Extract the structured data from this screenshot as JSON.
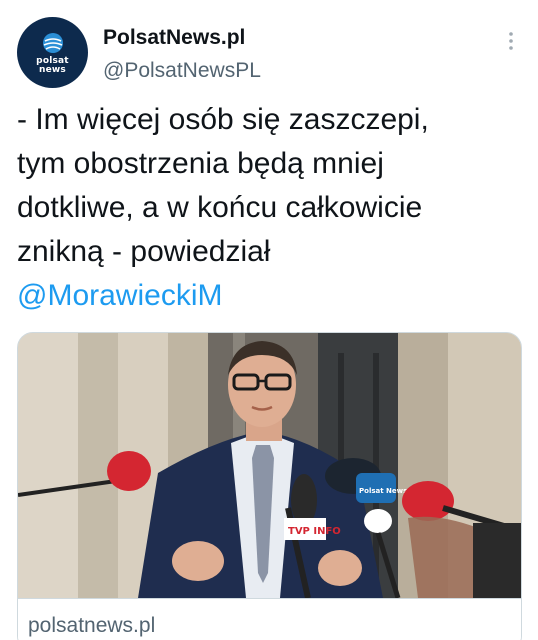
{
  "author": {
    "display_name": "PolsatNews.pl",
    "handle": "@PolsatNewsPL",
    "avatar_text_line1": "polsat",
    "avatar_text_line2": "news",
    "avatar_icon": "globe-icon"
  },
  "menu": {
    "icon": "more-vertical-icon"
  },
  "tweet": {
    "line1": "- Im więcej osób się zaszczepi,",
    "line2": "tym obostrzenia będą mniej",
    "line3": "dotkliwe, a w końcu całkowicie",
    "line4": "znikną - powiedział",
    "mention": "@MorawieckiM"
  },
  "card": {
    "domain": "polsatnews.pl",
    "image_description": "man in suit speaking to microphones",
    "mic_label_1": "TVP INFO",
    "mic_label_2": "Polsat News"
  },
  "colors": {
    "link": "#1d9bf0",
    "secondary_text": "#536471",
    "avatar_bg": "#0d2a4d",
    "border": "#cfd9de"
  }
}
